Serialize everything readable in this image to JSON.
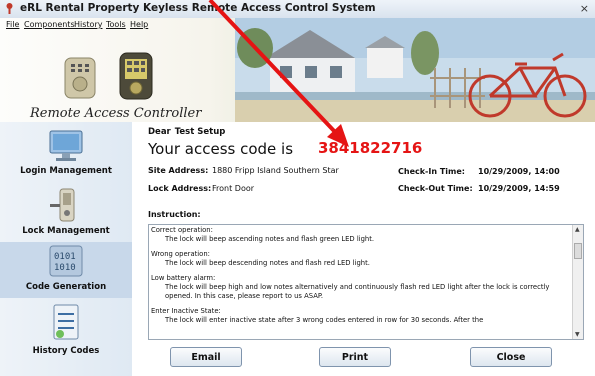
{
  "window": {
    "title": "eRL Rental Property Keyless Remote Access Control System",
    "close_glyph": "×"
  },
  "menu": [
    "File",
    "Components",
    "History",
    "Tools",
    "Help"
  ],
  "banner": {
    "brand": "Remote Access Controller"
  },
  "sidebar": {
    "items": [
      {
        "label": "Login Management",
        "icon": "monitor-icon",
        "active": false
      },
      {
        "label": "Lock Management",
        "icon": "lock-icon",
        "active": false
      },
      {
        "label": "Code Generation",
        "icon": "code-icon",
        "active": true
      },
      {
        "label": "History Codes",
        "icon": "history-icon",
        "active": false
      }
    ]
  },
  "main": {
    "greeting": "Dear",
    "user": "Test Setup",
    "access_label": "Your access code is",
    "access_code": "3841822716",
    "site_address_label": "Site Address:",
    "site_address": "1880 Fripp Island Southern Star",
    "lock_address_label": "Lock Address:",
    "lock_address": "Front Door",
    "checkin_label": "Check-In Time:",
    "checkin": "10/29/2009, 14:00",
    "checkout_label": "Check-Out Time:",
    "checkout": "10/29/2009, 14:59",
    "instruction_heading": "Instruction:",
    "instructions": [
      {
        "title": "Correct operation:",
        "text": "The lock will beep ascending notes and flash green LED light."
      },
      {
        "title": "Wrong operation:",
        "text": "The lock will beep descending notes and flash red LED light."
      },
      {
        "title": "Low battery alarm:",
        "text": "The lock will beep high and low notes alternatively and continuously flash red LED light after the lock is correctly opened. In this case, please report to us ASAP."
      },
      {
        "title": "Enter Inactive State:",
        "text": "The lock will enter inactive state after 3 wrong codes entered in row for 30 seconds. After the"
      }
    ]
  },
  "buttons": {
    "email": "Email",
    "print": "Print",
    "close": "Close"
  },
  "colors": {
    "access_code": "#e51414",
    "annotation_arrow": "#e51414"
  }
}
